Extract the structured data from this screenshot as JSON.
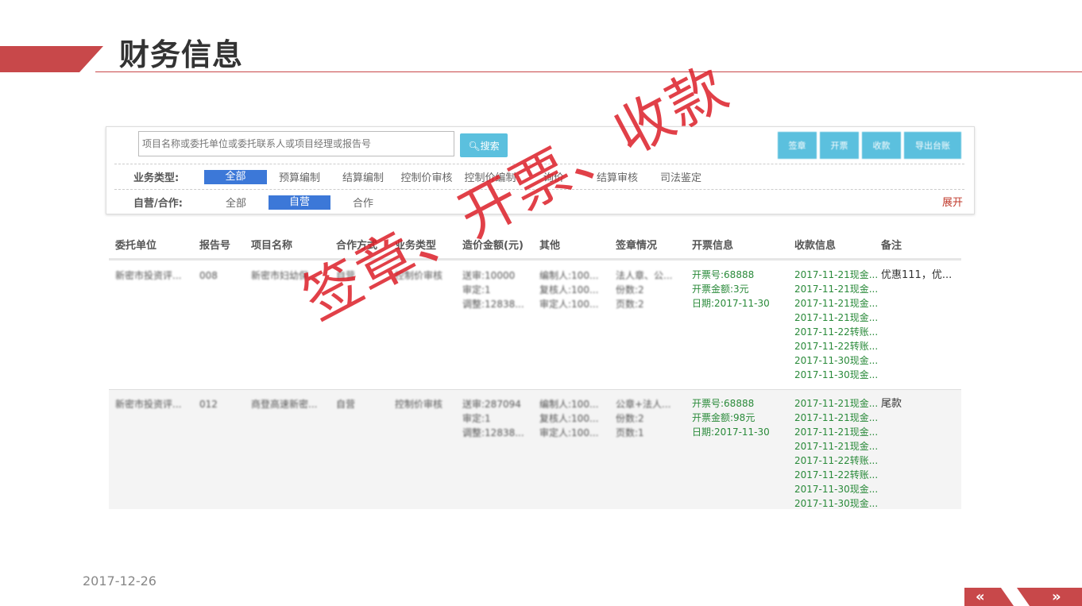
{
  "page": {
    "title": "财务信息",
    "date": "2017-12-26"
  },
  "search": {
    "placeholder": "项目名称或委托单位或委托联系人或项目经理或报告号",
    "button_label": "搜索"
  },
  "actions": [
    "签章",
    "开票",
    "收款",
    "导出台账"
  ],
  "filters": {
    "business_type": {
      "label": "业务类型:",
      "options": [
        "全部",
        "预算编制",
        "结算编制",
        "控制价审核",
        "控制价编制",
        "询价",
        "结算审核",
        "司法鉴定"
      ],
      "selected": "全部"
    },
    "operation": {
      "label": "自营/合作:",
      "options": [
        "全部",
        "自营",
        "合作"
      ],
      "selected": "自营"
    },
    "expand_label": "展开"
  },
  "table": {
    "headers": [
      "委托单位",
      "报告号",
      "项目名称",
      "合作方式",
      "业务类型",
      "造价金额(元)",
      "其他",
      "签章情况",
      "开票信息",
      "收款信息",
      "备注"
    ],
    "rows": [
      {
        "client": "新密市投资评...",
        "report_no": "008",
        "project": "新密市妇幼保...",
        "coop": "自营",
        "biz_type": "控制价审核",
        "amount": [
          "送审:10000",
          "审定:1",
          "调整:12838..."
        ],
        "other": [
          "编制人:100...",
          "复核人:100...",
          "审定人:100..."
        ],
        "seal": [
          "法人章、公...",
          "份数:2",
          "页数:2"
        ],
        "invoice": [
          "开票号:68888",
          "开票金额:3元",
          "日期:2017-11-30"
        ],
        "payments": [
          "2017-11-21现金...",
          "2017-11-21现金...",
          "2017-11-21现金...",
          "2017-11-21现金...",
          "2017-11-22转账...",
          "2017-11-22转账...",
          "2017-11-30现金...",
          "2017-11-30现金..."
        ],
        "remark": "优惠111，优..."
      },
      {
        "client": "新密市投资评...",
        "report_no": "012",
        "project": "商登高速新密...",
        "coop": "自营",
        "biz_type": "控制价审核",
        "amount": [
          "送审:287094",
          "审定:1",
          "调整:12838..."
        ],
        "other": [
          "编制人:100...",
          "复核人:100...",
          "审定人:100..."
        ],
        "seal": [
          "公章+法人...",
          "份数:2",
          "页数:1"
        ],
        "invoice": [
          "开票号:68888",
          "开票金额:98元",
          "日期:2017-11-30"
        ],
        "payments": [
          "2017-11-21现金...",
          "2017-11-21现金...",
          "2017-11-21现金...",
          "2017-11-21现金...",
          "2017-11-22转账...",
          "2017-11-22转账...",
          "2017-11-30现金...",
          "2017-11-30现金..."
        ],
        "remark": "尾款"
      }
    ]
  },
  "overlay_text": "签章、开票、收款",
  "nav": {
    "prev": "«",
    "next": "»"
  },
  "colors": {
    "accent_red": "#c8484a",
    "button_blue": "#5bc0de",
    "selected_blue": "#3c78d8",
    "green_text": "#2a8a3a"
  }
}
